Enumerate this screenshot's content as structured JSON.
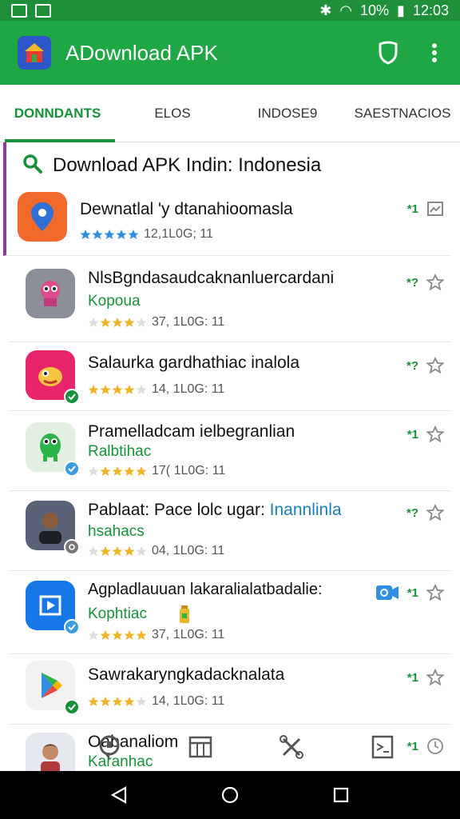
{
  "status_bar": {
    "battery": "10%",
    "time": "12:03"
  },
  "app_bar": {
    "title": "ADownload APK"
  },
  "tabs": [
    {
      "label": "DONNDANTS"
    },
    {
      "label": "ELOS"
    },
    {
      "label": "INDOSE9"
    },
    {
      "label": "SAESTNACIOS"
    }
  ],
  "section": {
    "title": "Download APK Indin: Indonesia"
  },
  "apps": [
    {
      "name": "Dewnatlal 'y dtanahioomasla",
      "sub": "",
      "meta": "12,1L0G; 11",
      "rank": "*1",
      "icon_color": "#f16a2b",
      "rating": 5
    },
    {
      "name": "NlsBgndasaudcaknanluercardani",
      "sub": "Kopoua",
      "meta": "37, 1L0G: 11",
      "rank": "*?",
      "icon_color": "#8d8f98",
      "rating": 3
    },
    {
      "name": "Salaurka gardhathiac inalola",
      "sub": "",
      "meta": "14, 1L0G: 11",
      "rank": "*?",
      "icon_color": "#e8256a",
      "rating": 4
    },
    {
      "name": "Pramelladcam ielbegranlian",
      "sub": "Ralbtihac",
      "meta": "17( 1L0G: 11",
      "rank": "*1",
      "icon_color": "#e3efe0",
      "rating": 4
    },
    {
      "name": "Pablaat: Pace lolc ugar:",
      "name_hl": "Inannlinla",
      "sub": "hsahacs",
      "meta": "04, 1L0G: 11",
      "rank": "*?",
      "icon_color": "#5a6278",
      "rating": 3
    },
    {
      "name": "Agpladlauuan lakaralialatbadalie:",
      "sub": "Kophtiac",
      "meta": "37, 1L0G: 11",
      "rank": "*1",
      "icon_color": "#1677e6",
      "rating": 4
    },
    {
      "name": "Sawrakaryngkadacknalata",
      "sub": "",
      "meta": "14, 1L0G: 11",
      "rank": "*1",
      "icon_color": "#f1f1f1",
      "rating": 4
    },
    {
      "name": "Oabanaliom",
      "sub": "Karanhac",
      "meta": "",
      "rank": "*1",
      "icon_color": "#e5e8ee",
      "rating": 0
    }
  ]
}
